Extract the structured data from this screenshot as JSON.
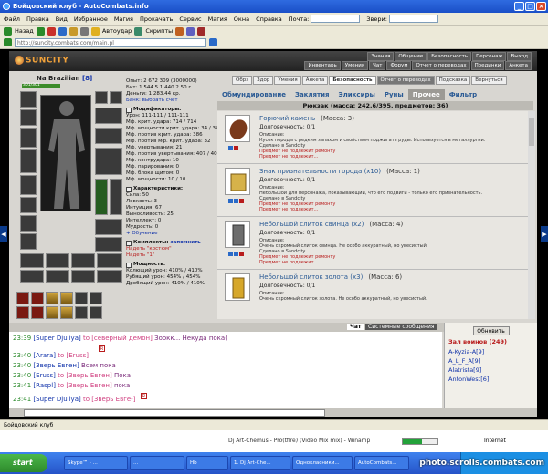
{
  "browser": {
    "title": "Бойцовский клуб - AutoCombats.info",
    "menu": [
      "Файл",
      "Правка",
      "Вид",
      "Избранное",
      "Магия",
      "Прокачать",
      "Сервис",
      "Магия",
      "Окна",
      "Справка"
    ],
    "field1_label": "Почта:",
    "field2_label": "Звери:",
    "address": "http://suncity.combats.com/main.pl",
    "toolbar_buttons": [
      "Назад",
      "Автоудар",
      "Скрипты"
    ],
    "status": "Бойцовский клуб"
  },
  "game": {
    "brand": "SUNCITY",
    "nav_top": [
      "Знания",
      "Общение",
      "Безопасность",
      "Персонаж",
      "Выход"
    ],
    "nav_bottom": [
      "Инвентарь",
      "Умения",
      "Чат",
      "Форум",
      "Отчет о переводах",
      "Поединки",
      "Анкета"
    ],
    "character": {
      "name": "Na Brazilian",
      "level": "[8]",
      "hp": "301/301"
    },
    "stats": {
      "exp": "Опыт: 2 672 309 (3000000)",
      "money": "Бит: 1 544.5  1 440.2  50 г",
      "money2": "Деньги: 1 283.44 кр.",
      "rep": "Банк: выбрать счет",
      "mods_title": "Модификаторы:",
      "mods": [
        "Урон: 111-111 / 111-111",
        "Мф. крит. удара: 714 / 714",
        "Мф. мощности крит. удара: 34 / 34",
        "Мф. против крит. удара: 386",
        "Мф. против мф. крит. удара: 32",
        "Мф. увертывания: 21",
        "Мф. против увертывания: 407 / 407",
        "Мф. контрудара: 10",
        "Мф. парирования: 0",
        "Мф. блока щитом: 0",
        "Мф. мощности: 10 / 10"
      ],
      "chars_title": "Характеристики:",
      "chars": [
        "Сила: 50",
        "Ловкость: 3",
        "Интуиция: 67",
        "Выносливость: 25",
        "Интеллект: 0",
        "Мудрость: 0"
      ],
      "upgrade": "+ Обучение",
      "sets_title": "Комплекты:",
      "sets_link": "запомнить",
      "sets": [
        "Надеть \"костюм\"",
        "Надеть \"1\""
      ],
      "power_title": "Мощность:",
      "power": [
        "Колющий урон: 410% / 410%",
        "Рубящий урон: 454% / 454%",
        "Дробящий урон: 410% / 410%"
      ]
    },
    "tabs_top": [
      "Обрз",
      "Здор",
      "Умения",
      "Анкета",
      "Безопасность",
      "Отчет о переводах",
      "Подсказка",
      "Вернуться"
    ],
    "categories": [
      "Обмундирование",
      "Заклятия",
      "Эликсиры",
      "Руны",
      "Прочее",
      "Фильтр"
    ],
    "backpack": "Рюкзак (масса: 242.6/395, предметов: 36)",
    "items": [
      {
        "title": "Горючий камень",
        "mass": "(Масса: 3)",
        "durability": "Долговечность: 0/1",
        "desc_title": "Описание:",
        "desc": "Кусок породы с редким запахом и свойством поджигать руды. Используется в металлургии.",
        "made": "Сделано в Sandcity",
        "warn": [
          "Предмет не подлежит ремонту",
          "Предмет не подлежит..."
        ]
      },
      {
        "title": "Знак признательности города",
        "count": "(x10)",
        "mass": "(Масса: 1)",
        "durability": "Долговечность: 0/1",
        "desc_title": "Описание:",
        "desc": "Небольшой для персонажа, показывающий, что его подвиги - только его признательность.",
        "made": "Сделано в Sandcity",
        "warn": [
          "Предмет не подлежит ремонту",
          "Предмет не подлежит..."
        ]
      },
      {
        "title": "Небольшой слиток свинца",
        "count": "(x2)",
        "mass": "(Масса: 4)",
        "durability": "Долговечность: 0/1",
        "desc_title": "Описание:",
        "desc": "Очень скромный слиток свинца. Не особо аккуратный, но увесистый.",
        "made": "Сделано в Sandcity",
        "warn": [
          "Предмет не подлежит ремонту",
          "Предмет не подлежит..."
        ]
      },
      {
        "title": "Небольшой слиток золота",
        "count": "(x3)",
        "mass": "(Масса: 6)",
        "durability": "Долговечность: 0/1",
        "desc_title": "Описание:",
        "desc": "Очень скромный слиток золота. Не особо аккуратный, но увесистый.",
        "made": "",
        "warn": []
      }
    ],
    "chat_tabs": [
      "Чат",
      "Системные сообщения"
    ],
    "chat": [
      {
        "time": "23:39",
        "nick": "[Super Djuliya]",
        "to": "to [северный демон]",
        "msg": "Зоокк... Некуда пока("
      },
      {
        "time": "23:40",
        "nick": "[Arara]",
        "to": "to [Eruss]",
        "msg": ""
      },
      {
        "time": "23:40",
        "nick": "[Зверь Евген]",
        "to": "",
        "msg": "Всем пока"
      },
      {
        "time": "23:40",
        "nick": "[Eruss]",
        "to": "to [Зверь Евген]",
        "msg": "Пока"
      },
      {
        "time": "23:41",
        "nick": "[Raspl]",
        "to": "to [Зверь Евген]",
        "msg": "пока"
      },
      {
        "time": "23:41",
        "nick": "[Super Djuliya]",
        "to": "to [Зверь Евге-]",
        "msg": ""
      }
    ],
    "who": {
      "refresh": "Обновить",
      "place": "Зал воинов (249)",
      "players": [
        "A-Kyzia-A[9]",
        "A_L_F_A[9]",
        "Alatrista[9]",
        "AntonWest[6]"
      ]
    }
  },
  "status_bar": {
    "winamp": "Dj Art-Chemus - Pro(tfire) (Video Mix mix) - Winamp",
    "zone": "Internet",
    "progress": 0.55
  },
  "taskbar": {
    "start": "start",
    "items": [
      "Skype™ - ...",
      "...",
      "Hb",
      "1. Dj Art-Che...",
      "Однокласники...",
      "AutoCombats..."
    ],
    "watermark": "photo.scrolls.combats.com"
  }
}
